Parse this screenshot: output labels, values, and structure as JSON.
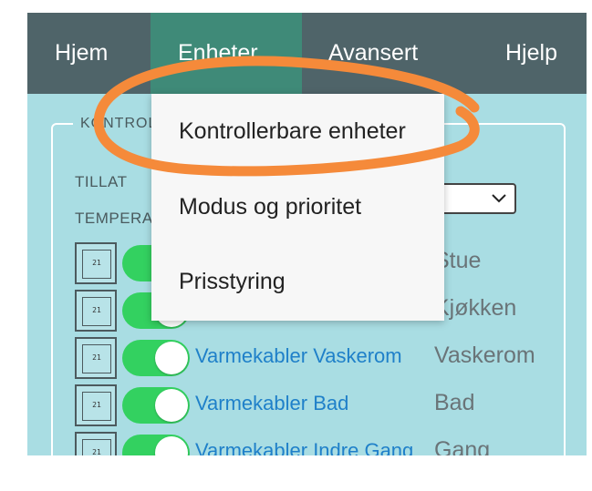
{
  "nav": {
    "items": [
      {
        "label": "Hjem"
      },
      {
        "label": "Enheter"
      },
      {
        "label": "Avansert"
      },
      {
        "label": "Hjelp"
      }
    ],
    "active_index": 1
  },
  "section": {
    "legend": "KONTROL",
    "label_allow": "TILLAT",
    "label_temp": "TEMPERA"
  },
  "thermostat_display": "21",
  "devices": [
    {
      "name": "",
      "room": "Stue",
      "enabled": true
    },
    {
      "name": "",
      "room": "Kjøkken",
      "enabled": true
    },
    {
      "name": "Varmekabler Vaskerom",
      "room": "Vaskerom",
      "enabled": true
    },
    {
      "name": "Varmekabler Bad",
      "room": "Bad",
      "enabled": true
    },
    {
      "name": "Varmekabler Indre Gang",
      "room": "Gang",
      "enabled": true
    }
  ],
  "dropdown": {
    "items": [
      {
        "label": "Kontrollerbare enheter"
      },
      {
        "label": "Modus og prioritet"
      },
      {
        "label": "Prisstyring"
      }
    ]
  },
  "colors": {
    "navbar": "#4f6469",
    "nav_active": "#3f8a78",
    "background": "#a9dde3",
    "toggle_on": "#33d160",
    "link": "#1f80c9",
    "annotation": "#f58a3a"
  }
}
